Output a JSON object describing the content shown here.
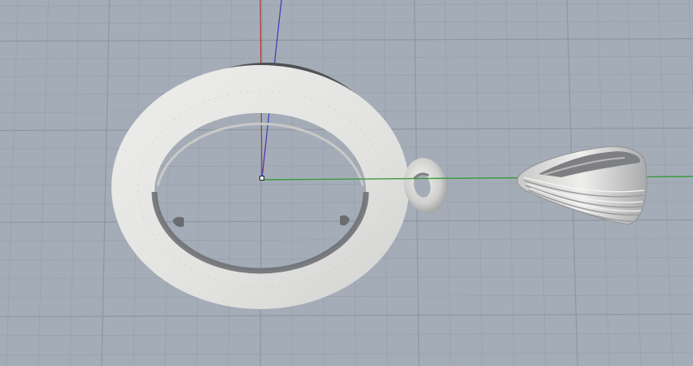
{
  "viewport": {
    "background_color": "#a4adb7",
    "grid_minor_color": "#99a2ac",
    "grid_major_color": "#8e97a1",
    "axis_x_color": "#3c9a3c",
    "axis_y_color": "#b03a3a",
    "axis_z_color": "#3a3ab8"
  },
  "objects": {
    "ring_color": "#e4e4e2",
    "ring_shadow_color": "#5e6064",
    "bail_color": "#d8d8d6",
    "origin_marker_color": "#ffffff"
  }
}
